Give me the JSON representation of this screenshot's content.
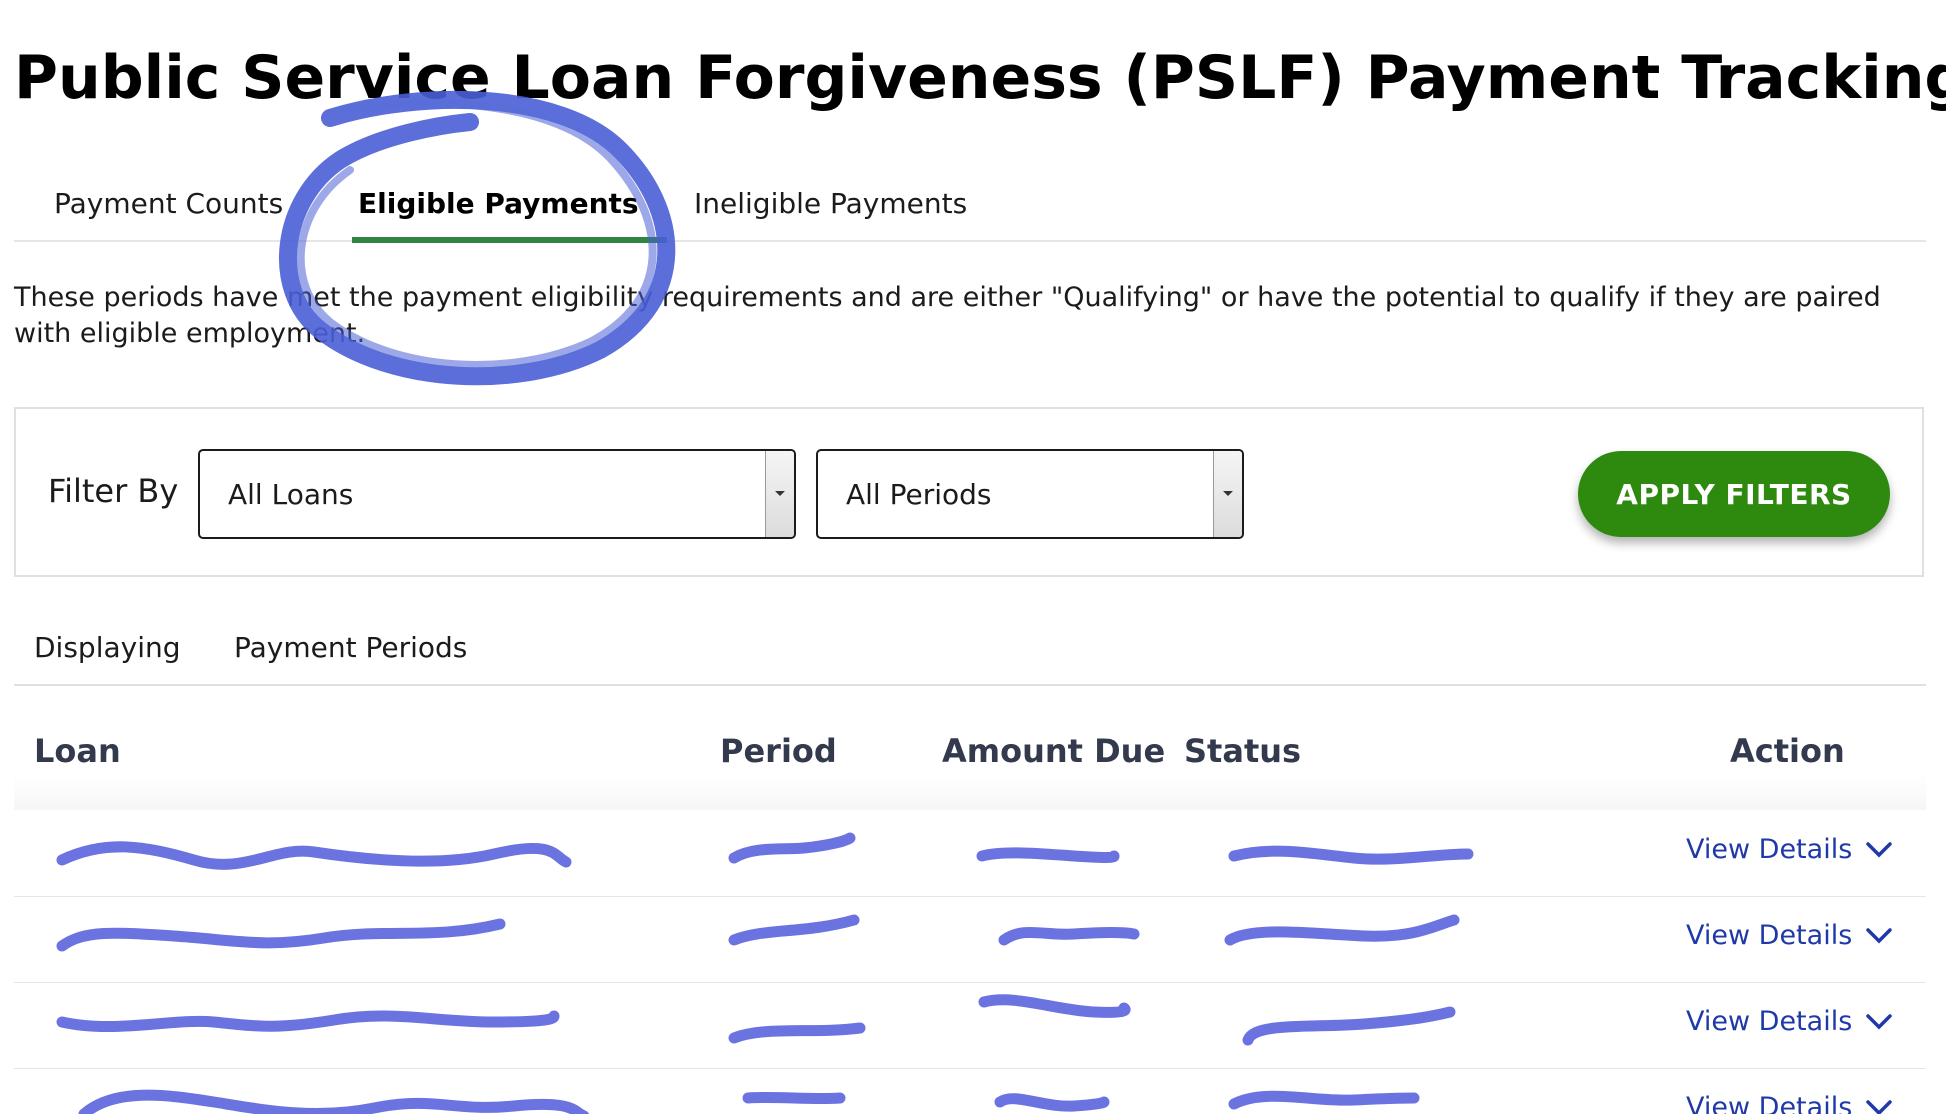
{
  "page": {
    "title": "Public Service Loan Forgiveness (PSLF) Payment Tracking"
  },
  "tabs": [
    {
      "label": "Payment Counts",
      "active": false
    },
    {
      "label": "Eligible Payments",
      "active": true
    },
    {
      "label": "Ineligible Payments",
      "active": false
    }
  ],
  "description": "These periods have met the payment eligibility requirements and are either \"Qualifying\" or have the potential to qualify if they are paired with eligible employment.",
  "filter": {
    "label": "Filter By",
    "loan_select_value": "All Loans",
    "period_select_value": "All Periods",
    "apply_label": "APPLY FILTERS"
  },
  "display": {
    "label": "Displaying",
    "value": "Payment Periods"
  },
  "table": {
    "headers": {
      "loan": "Loan",
      "period": "Period",
      "amount_due": "Amount Due",
      "status": "Status",
      "action": "Action"
    },
    "rows": [
      {
        "action_label": "View Details",
        "redacted": true
      },
      {
        "action_label": "View Details",
        "redacted": true
      },
      {
        "action_label": "View Details",
        "redacted": true
      },
      {
        "action_label": "View Details",
        "redacted": true
      }
    ]
  },
  "colors": {
    "active_tab_underline": "#2e8540",
    "apply_button": "#2e8a0f",
    "link": "#1f3aa8",
    "redaction_marker": "#6b73e0",
    "annotation_circle": "#4a5fd6"
  },
  "icons": {
    "select_arrow": "caret-down-icon",
    "row_expand": "chevron-down-icon"
  }
}
